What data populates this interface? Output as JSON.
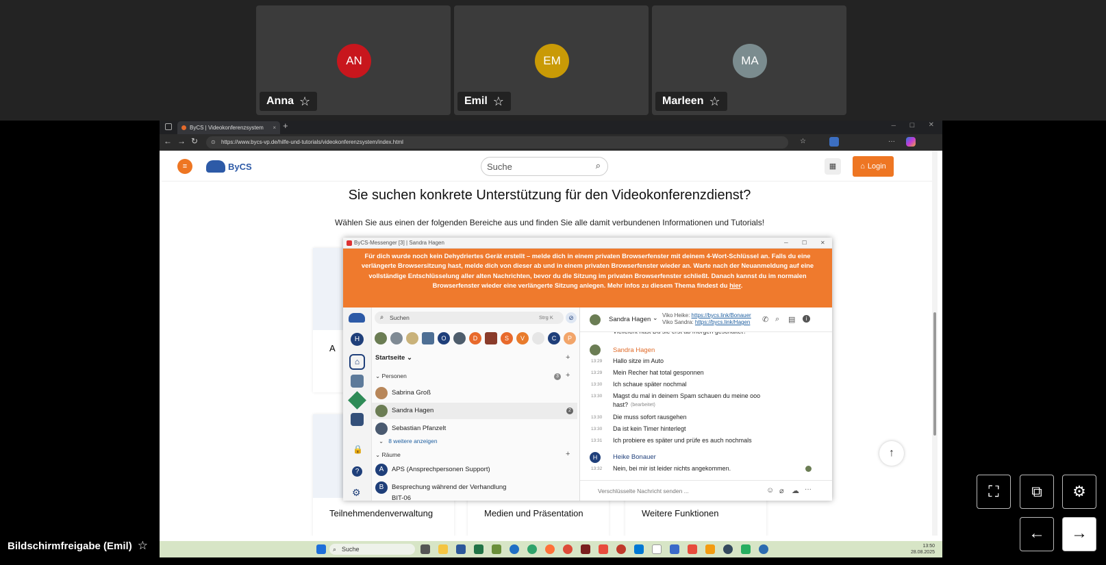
{
  "participants": [
    {
      "initials": "AN",
      "name": "Anna",
      "color": "#c8161d"
    },
    {
      "initials": "EM",
      "name": "Emil",
      "color": "#c99a06"
    },
    {
      "initials": "MA",
      "name": "Marleen",
      "color": "#7b8c8f"
    }
  ],
  "screenshare_label": "Bildschirmfreigabe (Emil)",
  "browser": {
    "tab_title": "ByCS | Videokonferenzsystem",
    "url": "https://www.bycs-vp.de/hilfe-und-tutorials/videokonferenzsystem/index.html"
  },
  "site": {
    "logo_text": "ByCS",
    "search_placeholder": "Suche",
    "login_label": "Login",
    "heading": "Sie suchen konkrete Unterstützung für den Videokonferenzdienst?",
    "subheading": "Wählen Sie aus einen der folgenden Bereiche aus und finden Sie alle damit verbundenen Informationen und Tutorials!",
    "card_partial": "A",
    "cards": [
      "Teilnehmendenverwaltung",
      "Medien und Präsentation",
      "Weitere Funktionen"
    ]
  },
  "messenger": {
    "window_title": "ByCS-Messenger [3] | Sandra Hagen",
    "banner_pre": "Für dich wurde noch kein Dehydriertes Gerät erstellt – melde dich in einem privaten Browserfenster mit deinem 4-Wort-Schlüssel an. Falls du eine verlängerte Browsersitzung hast, melde dich von dieser ab und in einem privaten Browserfenster wieder an. Warte nach der Neuanmeldung auf eine vollständige Entschlüsselung aller alten Nachrichten, bevor du die Sitzung im privaten Browserfenster schließt. Danach kannst du im normalen Browserfenster wieder eine verlängerte Sitzung anlegen. Mehr Infos zu diesem Thema findest du ",
    "banner_link": "hier",
    "search_placeholder": "Suchen",
    "search_shortcut": "Strg K",
    "space_badge": "H",
    "home_label": "Startseite",
    "persons_label": "Personen",
    "persons_count": "3",
    "persons": [
      {
        "name": "Sabrina Groß",
        "badge": ""
      },
      {
        "name": "Sandra Hagen",
        "badge": "2"
      },
      {
        "name": "Sebastian Pfanzelt",
        "badge": ""
      }
    ],
    "more_label": "8 weitere anzeigen",
    "rooms_label": "Räume",
    "rooms": [
      {
        "letter": "A",
        "name": "APS (Ansprechpersonen Support)"
      },
      {
        "letter": "B",
        "name": "Besprechung während der Verhandlung"
      },
      {
        "letter": "",
        "name": "BIT-06"
      }
    ],
    "recent_letters": [
      "O",
      "D",
      "S",
      "V",
      "C",
      "P"
    ],
    "chat_name": "Sandra Hagen",
    "links": [
      {
        "label": "Viko Heike: ",
        "url": "https://bycs.link/Bonauer"
      },
      {
        "label": "Viko Sandra: ",
        "url": "https://bycs.link/Hagen"
      }
    ],
    "cut_message": "Vielleicht hast Du sie erst ab morgen geschaltet?",
    "sender1": "Sandra Hagen",
    "messages1": [
      {
        "time": "13:29",
        "text": "Hallo sitze im Auto"
      },
      {
        "time": "13:29",
        "text": "Mein Recher hat total gesponnen"
      },
      {
        "time": "13:30",
        "text": "Ich schaue später nochmal"
      },
      {
        "time": "13:30",
        "text": "Magst du mal in deinem Spam schauen du meine ooo",
        "text2": "hast?",
        "edited": "(bearbeitet)"
      },
      {
        "time": "13:30",
        "text": "Die muss sofort rausgehen"
      },
      {
        "time": "13:30",
        "text": "Da ist kein Timer hinterlegt"
      },
      {
        "time": "13:31",
        "text": "Ich probiere es später und prüfe es auch nochmals"
      }
    ],
    "sender2": "Heike Bonauer",
    "sender2_initial": "H",
    "messages2": [
      {
        "time": "13:32",
        "text": "Nein, bei mir ist leider nichts angekommen."
      }
    ],
    "composer_placeholder": "Verschlüsselte Nachricht senden ..."
  },
  "taskbar": {
    "search_label": "Suche",
    "time": "13:50",
    "date": "28.08.2025"
  }
}
